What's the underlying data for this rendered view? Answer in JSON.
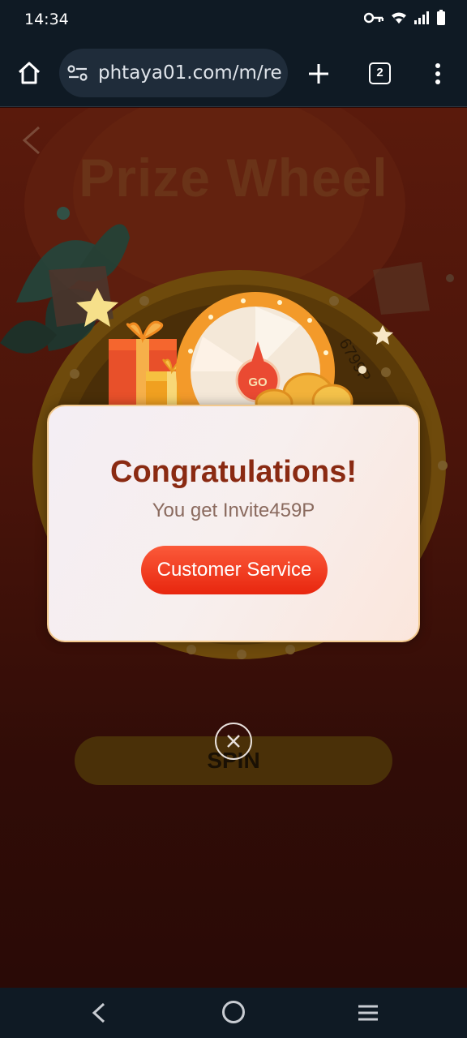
{
  "status_bar": {
    "time": "14:34"
  },
  "browser": {
    "url": "phtaya01.com/m/re",
    "tab_count": "2"
  },
  "page": {
    "title": "Prize Wheel",
    "wheel_label": "6799P",
    "spin_label": "SPIN"
  },
  "modal": {
    "title": "Congratulations!",
    "message": "You get Invite459P",
    "button_label": "Customer Service"
  },
  "colors": {
    "accent": "#f2361a",
    "title": "#8a2a12",
    "background": "#2a0a06"
  }
}
